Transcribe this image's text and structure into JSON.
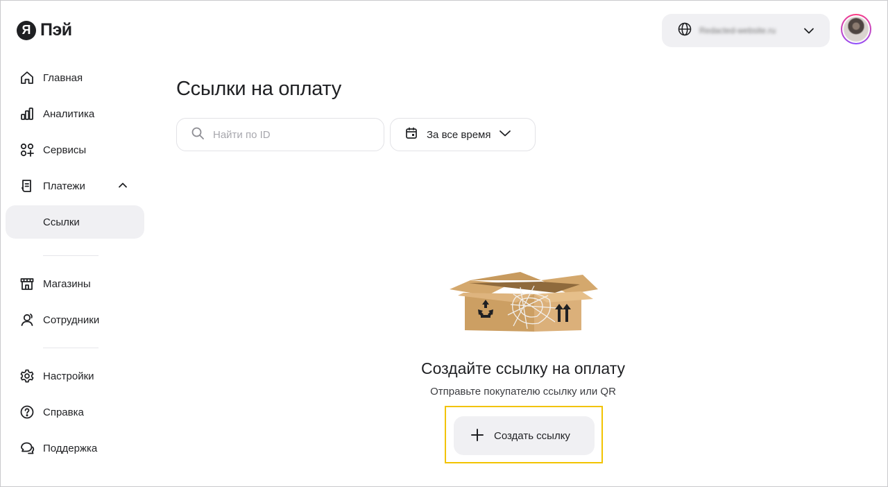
{
  "brand": {
    "mark": "Я",
    "name": "Пэй"
  },
  "sidebar": {
    "items": [
      {
        "label": "Главная",
        "icon": "home-icon"
      },
      {
        "label": "Аналитика",
        "icon": "analytics-icon"
      },
      {
        "label": "Сервисы",
        "icon": "services-icon"
      },
      {
        "label": "Платежи",
        "icon": "payments-icon",
        "expanded": true
      },
      {
        "label": "Ссылки",
        "active": true
      },
      {
        "label": "Магазины",
        "icon": "store-icon"
      },
      {
        "label": "Сотрудники",
        "icon": "employees-icon"
      },
      {
        "label": "Настройки",
        "icon": "gear-icon"
      },
      {
        "label": "Справка",
        "icon": "help-icon"
      },
      {
        "label": "Поддержка",
        "icon": "chat-icon"
      }
    ]
  },
  "header": {
    "shop_selector": {
      "name": "Redacted-website.ru"
    }
  },
  "main": {
    "title": "Ссылки на оплату",
    "search": {
      "placeholder": "Найти по ID",
      "value": ""
    },
    "period": {
      "label": "За все время"
    },
    "empty_state": {
      "title": "Создайте ссылку на оплату",
      "subtitle": "Отправьте покупателю ссылку или QR",
      "button_label": "Создать ссылку"
    }
  },
  "colors": {
    "highlight": "#f2c300",
    "surface": "#f0f0f3",
    "text": "#1f2023"
  }
}
